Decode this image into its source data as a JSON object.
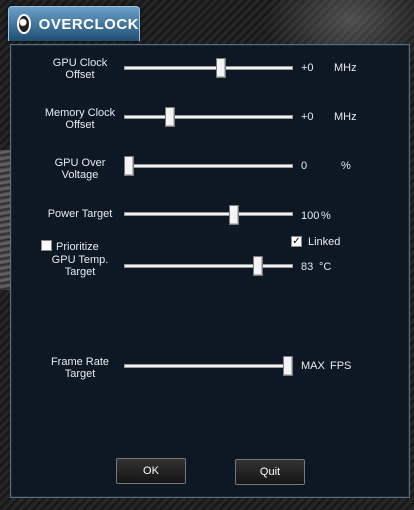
{
  "header": {
    "title": "OVERCLOCK"
  },
  "rows": {
    "gpu_clock": {
      "label_1": "GPU Clock",
      "label_2": "Offset",
      "value": "+0",
      "unit": "MHz",
      "level": 0.58
    },
    "memory_clock": {
      "label_1": "Memory Clock",
      "label_2": "Offset",
      "value": "+0",
      "unit": "MHz",
      "level": 0.26
    },
    "gpu_voltage": {
      "label_1": "GPU Over",
      "label_2": "Voltage",
      "value": "0",
      "unit": "%",
      "level": 0.0
    },
    "power_target": {
      "label": "Power Target",
      "value": "100",
      "unit": "%",
      "level": 0.66
    },
    "gpu_temp": {
      "checkbox_label": "Prioritize",
      "label_1": "GPU Temp.",
      "label_2": "Target",
      "value": "83",
      "unit": "°C",
      "level": 0.81,
      "prioritize_checked": false
    },
    "linked": {
      "label": "Linked",
      "checked": true
    },
    "frame_rate": {
      "label_1": "Frame Rate",
      "label_2": "Target",
      "value": "MAX",
      "unit": "FPS",
      "level": 1.0
    }
  },
  "buttons": {
    "ok": "OK",
    "quit": "Quit"
  }
}
